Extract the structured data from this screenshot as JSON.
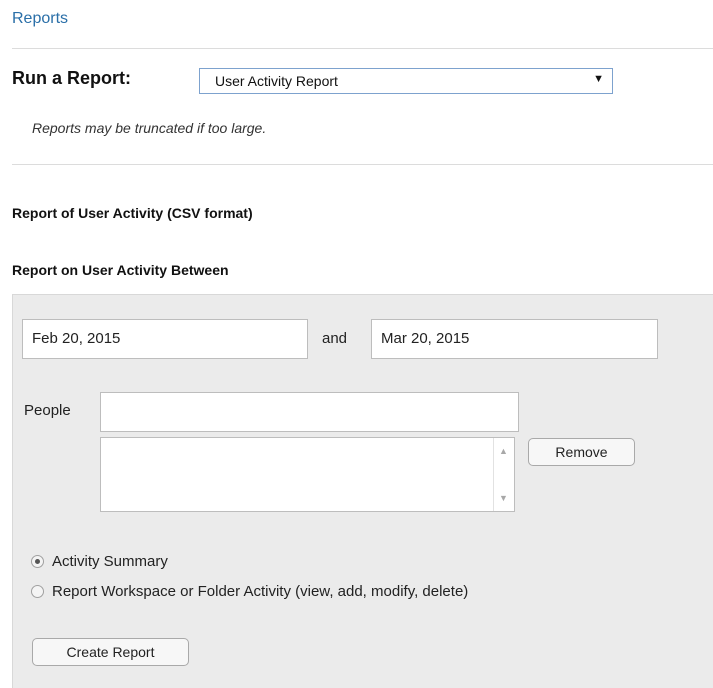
{
  "breadcrumb": "Reports",
  "run_report": {
    "label": "Run a Report:",
    "selected": "User Activity Report",
    "note": "Reports may be truncated if too large."
  },
  "section_title": "Report of User Activity (CSV format)",
  "between_title": "Report on User Activity Between",
  "date_range": {
    "start": "Feb 20, 2015",
    "and_label": "and",
    "end": "Mar 20, 2015"
  },
  "people": {
    "label": "People",
    "input_value": "",
    "remove_label": "Remove"
  },
  "options": {
    "activity_summary": "Activity Summary",
    "workspace_activity": "Report Workspace or Folder Activity (view, add, modify, delete)",
    "selected": "activity_summary"
  },
  "create_report_label": "Create Report",
  "icons": {
    "dropdown": "caret-down-icon",
    "scroll_up": "triangle-up-icon",
    "scroll_down": "triangle-down-icon"
  },
  "colors": {
    "link": "#2a6fa8",
    "panel_bg": "#ebebeb",
    "select_border": "#7da2ce"
  }
}
